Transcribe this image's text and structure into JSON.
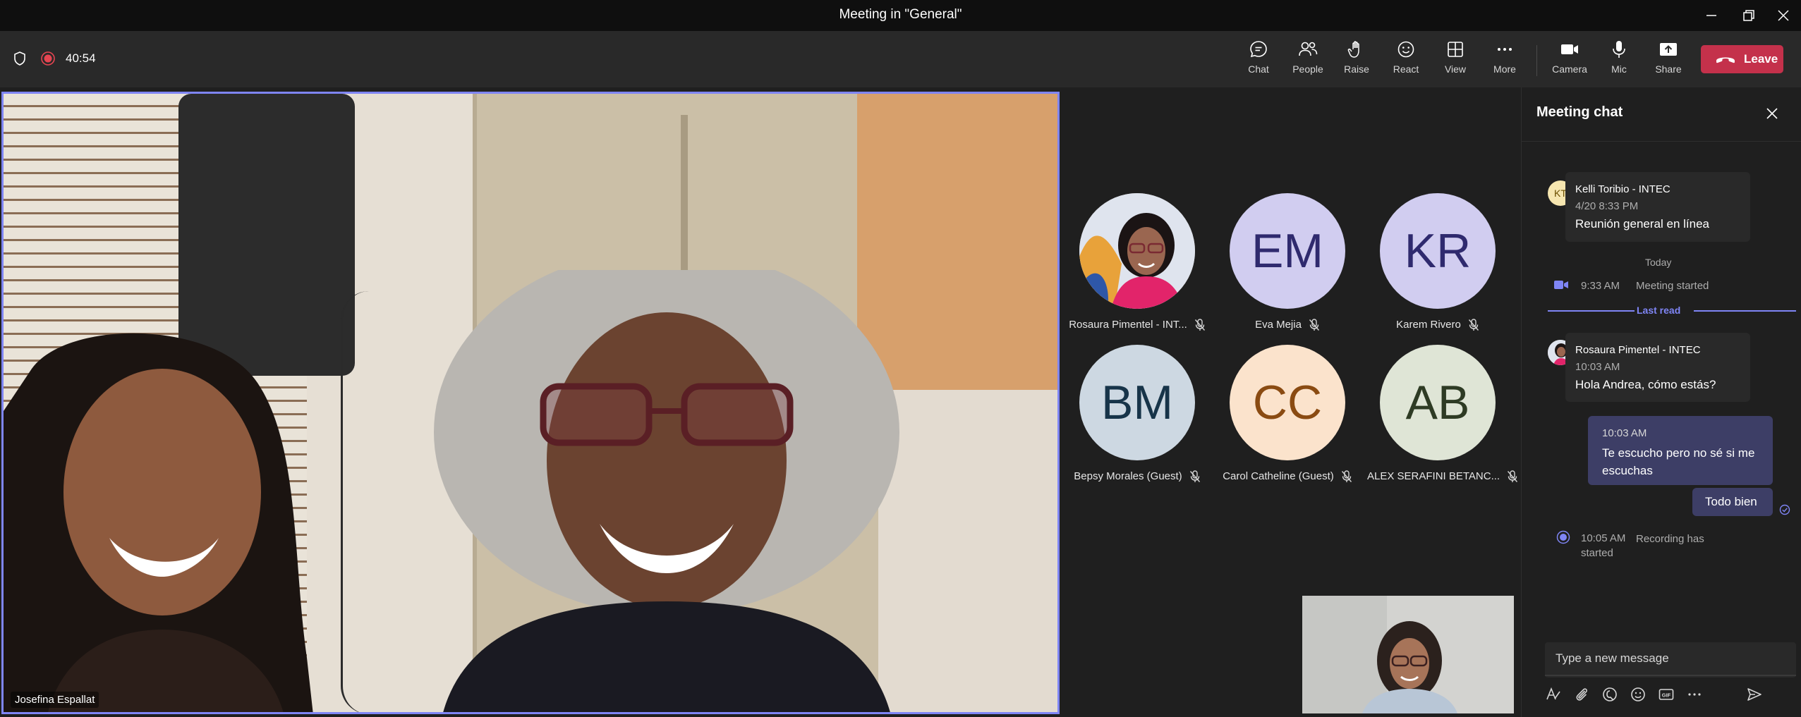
{
  "window": {
    "title": "Meeting in \"General\""
  },
  "toolbar": {
    "timer": "40:54",
    "buttons": {
      "chat": "Chat",
      "people": "People",
      "raise": "Raise",
      "react": "React",
      "view": "View",
      "more": "More",
      "camera": "Camera",
      "mic": "Mic",
      "share": "Share"
    },
    "leave": "Leave"
  },
  "main_video": {
    "name": "Josefina Espallat"
  },
  "participants": [
    {
      "name": "Rosaura Pimentel - INT...",
      "initials": "",
      "avatar_color": "#e4d9ce"
    },
    {
      "name": "Eva Mejia",
      "initials": "EM",
      "avatar_color": "#d1cdf0"
    },
    {
      "name": "Karem Rivero",
      "initials": "KR",
      "avatar_color": "#d1cdf0"
    },
    {
      "name": "Bepsy Morales (Guest)",
      "initials": "BM",
      "avatar_color": "#cdd8e2"
    },
    {
      "name": "Carol Catheline (Guest)",
      "initials": "CC",
      "avatar_color": "#fbe3cc"
    },
    {
      "name": "ALEX SERAFINI BETANC...",
      "initials": "AB",
      "avatar_color": "#dfe5d6"
    }
  ],
  "chat": {
    "title": "Meeting chat",
    "messages": [
      {
        "sender": "Kelli Toribio - INTEC",
        "initials": "KT",
        "time": "4/20 8:33 PM",
        "text": "Reunión general en línea"
      },
      {
        "sender": "Rosaura Pimentel - INTEC",
        "time": "10:03 AM",
        "text": "Hola Andrea, cómo estás?"
      }
    ],
    "today_label": "Today",
    "meeting_started": {
      "time": "9:33 AM",
      "text": "Meeting started"
    },
    "last_read": "Last read",
    "outgoing": [
      {
        "time": "10:03 AM",
        "text": "Te escucho pero no sé si me escuchas"
      },
      {
        "text": "Todo bien"
      }
    ],
    "recording": {
      "time": "10:05 AM",
      "text": "Recording has started"
    },
    "compose_placeholder": "Type a new message"
  },
  "colors": {
    "accent": "#7f85f5",
    "leave": "#c4314b",
    "recording": "#e54551"
  }
}
